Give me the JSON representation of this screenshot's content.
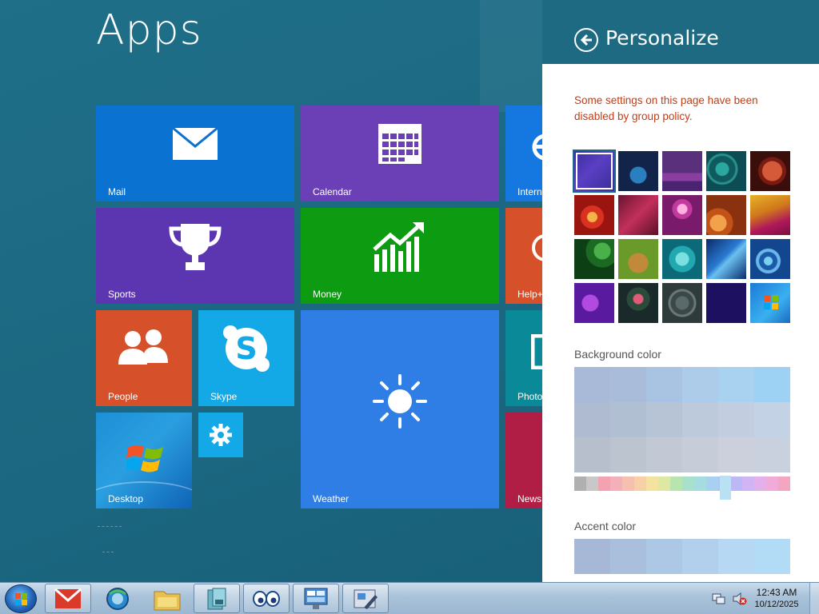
{
  "start_screen": {
    "title": "Apps",
    "tiles": {
      "mail": "Mail",
      "calendar": "Calendar",
      "internet": "Intern",
      "sports": "Sports",
      "money": "Money",
      "help": "Help+",
      "people": "People",
      "skype": "Skype",
      "weather": "Weather",
      "photos": "Photo",
      "desktop": "Desktop",
      "news": "News"
    }
  },
  "personalize_pane": {
    "title": "Personalize",
    "policy_message": "Some settings on this page have been disabled by group policy.",
    "background_color_label": "Background color",
    "accent_color_label": "Accent color"
  },
  "taskbar": {
    "time": "12:43 AM",
    "date": "10/12/2025",
    "pinned_icons": [
      "gmail-icon",
      "browser-icon",
      "file-explorer-icon",
      "backup-icon",
      "eyes-icon",
      "control-panel-icon",
      "settings-tools-icon"
    ]
  },
  "colors": {
    "start_background": "#1d6a82",
    "mail_tile": "#0a72d1",
    "calendar_tile": "#6b3fb5",
    "sports_tile": "#5c35b0",
    "money_tile": "#0d9b12",
    "people_tile": "#d6512a",
    "skype_tile": "#13a9e6",
    "weather_tile": "#2f7ee6",
    "policy_message": "#c43c12"
  }
}
